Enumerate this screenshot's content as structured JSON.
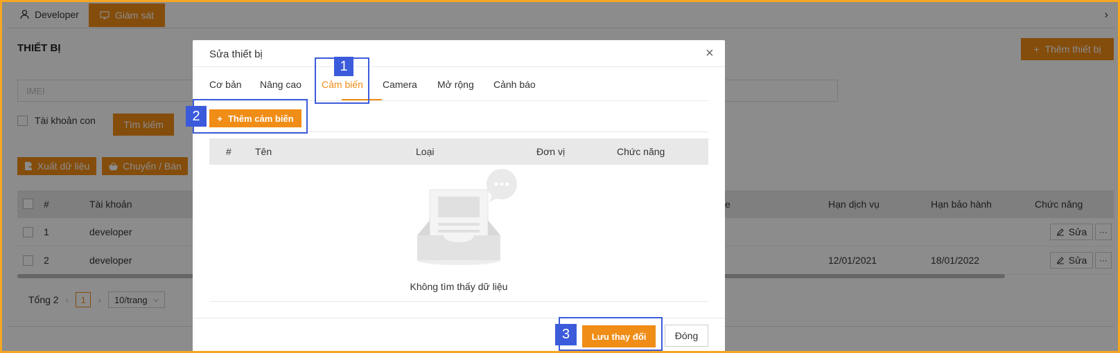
{
  "topbar": {
    "tab_developer": "Developer",
    "tab_monitor": "Giám sát",
    "chevron": "›"
  },
  "page": {
    "title": "THIẾT BỊ",
    "add_button": "Thêm thiết bị",
    "imei_placeholder": "IMEI",
    "subaccount_label": "Tài khoản con",
    "search_button": "Tìm kiếm",
    "export_button": "Xuất dữ liệu",
    "transfer_button": "Chuyển / Bán"
  },
  "table": {
    "headers": {
      "num": "#",
      "account": "Tài khoản",
      "vehicle": "xe",
      "service_expiry": "Hạn dịch vụ",
      "warranty_expiry": "Hạn bảo hành",
      "actions": "Chức năng"
    },
    "rows": [
      {
        "num": "1",
        "account": "developer",
        "service_expiry": "",
        "warranty_expiry": "",
        "edit": "Sửa",
        "more": "···"
      },
      {
        "num": "2",
        "account": "developer",
        "service_expiry": "12/01/2021",
        "warranty_expiry": "18/01/2022",
        "edit": "Sửa",
        "more": "···"
      }
    ]
  },
  "pagination": {
    "total": "Tổng 2",
    "current": "1",
    "page_size": "10/trang"
  },
  "modal": {
    "title": "Sửa thiết bị",
    "close": "×",
    "tabs": [
      "Cơ bản",
      "Nâng cao",
      "Cảm biến",
      "Camera",
      "Mở rộng",
      "Cảnh báo"
    ],
    "active_tab": "Cảm biến",
    "add_sensor_button": "Thêm cảm biến",
    "sensor_table": {
      "headers": {
        "num": "#",
        "name": "Tên",
        "type": "Loại",
        "unit": "Đơn vị",
        "actions": "Chức năng"
      }
    },
    "empty_text": "Không tìm thấy dữ liệu",
    "save_button": "Lưu thay đổi",
    "close_button": "Đóng"
  },
  "annotations": [
    {
      "label": "1"
    },
    {
      "label": "2"
    },
    {
      "label": "3"
    }
  ],
  "colors": {
    "accent": "#f08d17",
    "annotation": "#3b5bdb",
    "frame": "#f5a623"
  }
}
